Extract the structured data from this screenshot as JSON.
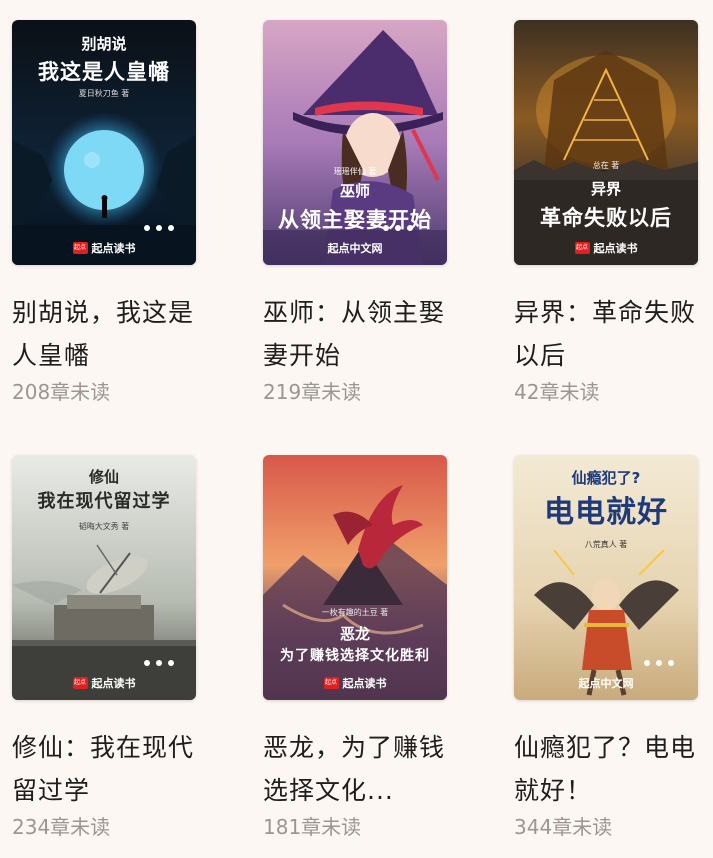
{
  "books": [
    {
      "title": "别胡说，我这是人皇幡",
      "unread": "208章未读",
      "cover": {
        "sub": "别胡说",
        "main": "我这是人皇幡",
        "author": "夏日秋刀鱼 著",
        "publisher": "起点读书",
        "logo": "起点"
      }
    },
    {
      "title": "巫师：从领主娶妻开始",
      "unread": "219章未读",
      "cover": {
        "sub": "巫师",
        "main": "从领主娶妻开始",
        "author": "瑶瑶伴仙 著",
        "publisher": "起点中文网",
        "logo": ""
      }
    },
    {
      "title": "异界：革命失败以后",
      "unread": "42章未读",
      "cover": {
        "sub": "异界",
        "main": "革命失败以后",
        "author": "总在 著",
        "publisher": "起点读书",
        "logo": "起点"
      }
    },
    {
      "title": "修仙：我在现代留过学",
      "unread": "234章未读",
      "cover": {
        "sub": "修仙",
        "main": "我在现代留过学",
        "author": "韬晦大文秀 著",
        "publisher": "起点读书",
        "logo": "起点"
      }
    },
    {
      "title": "恶龙，为了赚钱选择文化...",
      "unread": "181章未读",
      "cover": {
        "sub": "恶龙",
        "main": "为了赚钱选择文化胜利",
        "author": "一枚有趣的土豆 著",
        "publisher": "起点读书",
        "logo": "起点"
      }
    },
    {
      "title": "仙瘾犯了？电电就好！",
      "unread": "344章未读",
      "cover": {
        "sub": "仙瘾犯了?",
        "main": "电电就好",
        "author": "八荒真人 著",
        "publisher": "起点中文网",
        "logo": ""
      }
    }
  ]
}
